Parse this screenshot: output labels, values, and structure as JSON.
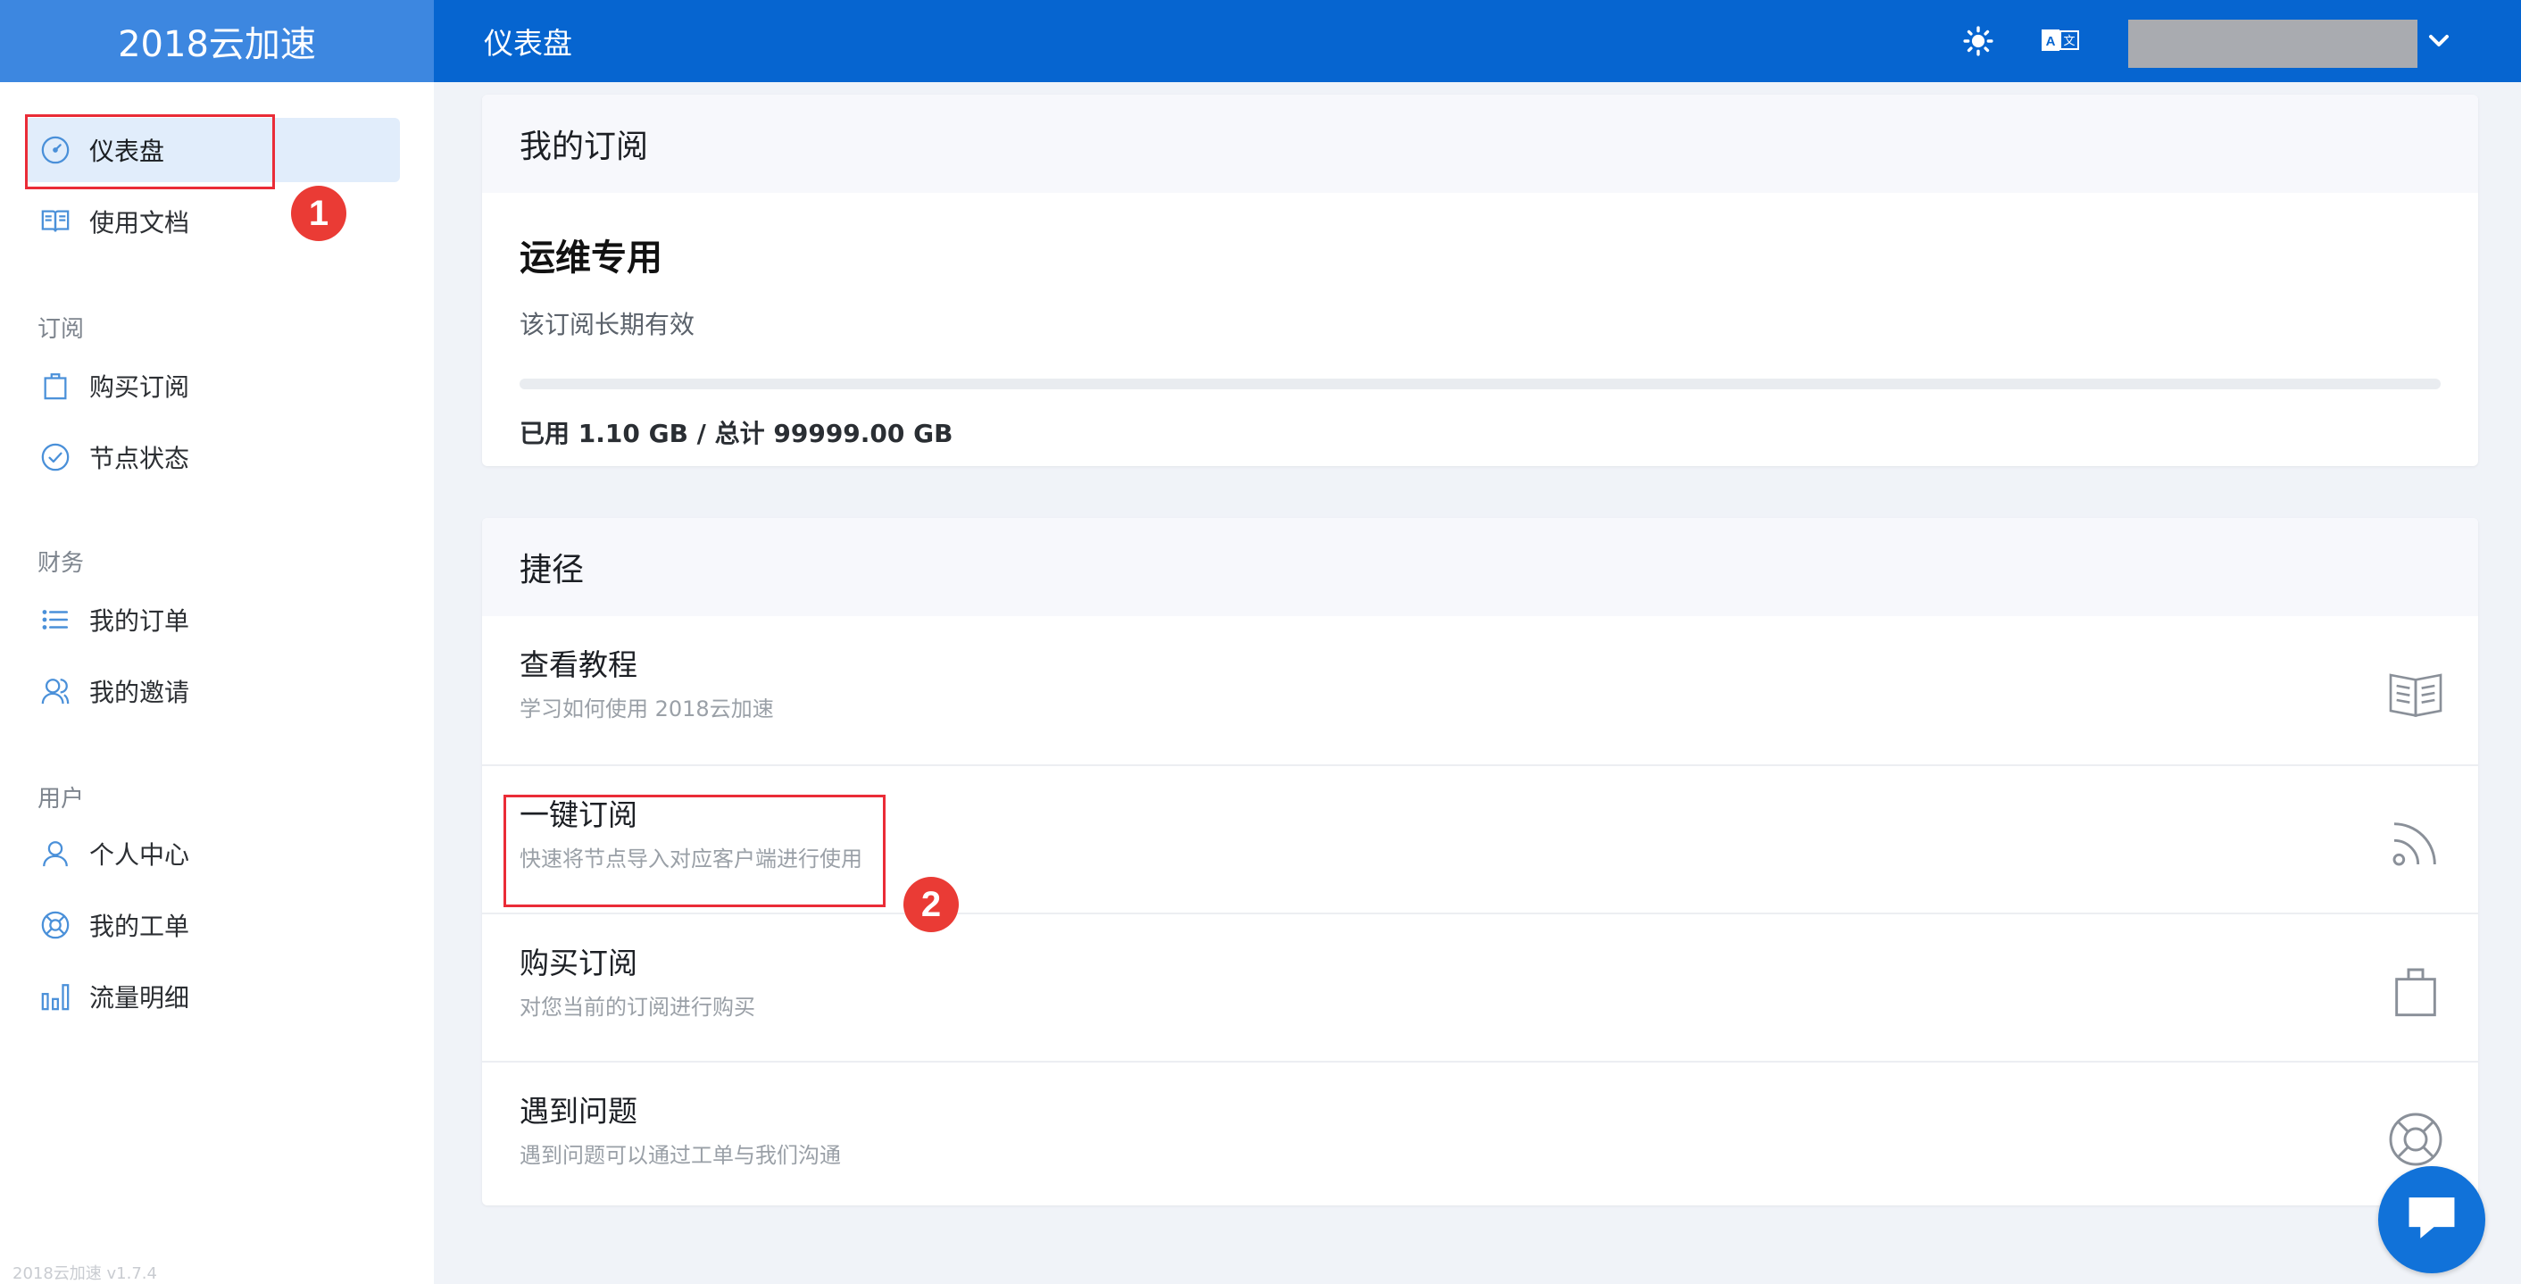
{
  "header": {
    "brand": "2018云加速",
    "page_title": "仪表盘",
    "theme_icon": "sun-icon",
    "lang_icon": "translate-icon",
    "user_dropdown_icon": "chevron-down-icon"
  },
  "sidebar": {
    "items_top": [
      {
        "label": "仪表盘",
        "icon": "dashboard-icon"
      },
      {
        "label": "使用文档",
        "icon": "book-icon"
      }
    ],
    "section_subscription": "订阅",
    "items_subscription": [
      {
        "label": "购买订阅",
        "icon": "shopping-bag-icon"
      },
      {
        "label": "节点状态",
        "icon": "check-circle-icon"
      }
    ],
    "section_finance": "财务",
    "items_finance": [
      {
        "label": "我的订单",
        "icon": "list-icon"
      },
      {
        "label": "我的邀请",
        "icon": "users-icon"
      }
    ],
    "section_user": "用户",
    "items_user": [
      {
        "label": "个人中心",
        "icon": "user-icon"
      },
      {
        "label": "我的工单",
        "icon": "lifebuoy-icon"
      },
      {
        "label": "流量明细",
        "icon": "bar-chart-icon"
      }
    ],
    "version": "2018云加速 v1.7.4"
  },
  "subscription": {
    "card_title": "我的订阅",
    "plan_name": "运维专用",
    "validity": "该订阅长期有效",
    "usage_text": "已用 1.10 GB / 总计 99999.00 GB",
    "usage_fraction": 1.1e-05
  },
  "shortcuts": {
    "card_title": "捷径",
    "items": [
      {
        "title": "查看教程",
        "desc": "学习如何使用 2018云加速",
        "icon": "book-open-icon"
      },
      {
        "title": "一键订阅",
        "desc": "快速将节点导入对应客户端进行使用",
        "icon": "rss-icon"
      },
      {
        "title": "购买订阅",
        "desc": "对您当前的订阅进行购买",
        "icon": "shopping-bag-icon"
      },
      {
        "title": "遇到问题",
        "desc": "遇到问题可以通过工单与我们沟通",
        "icon": "lifebuoy-icon"
      }
    ]
  },
  "annotations": {
    "badge_1": "1",
    "badge_2": "2"
  },
  "colors": {
    "header_bg": "#0665d0",
    "brand_bg": "#3d87e0",
    "highlight": "#ea2c37",
    "icon": "#4a90d9"
  },
  "chat_icon": "chat-bubble-icon"
}
